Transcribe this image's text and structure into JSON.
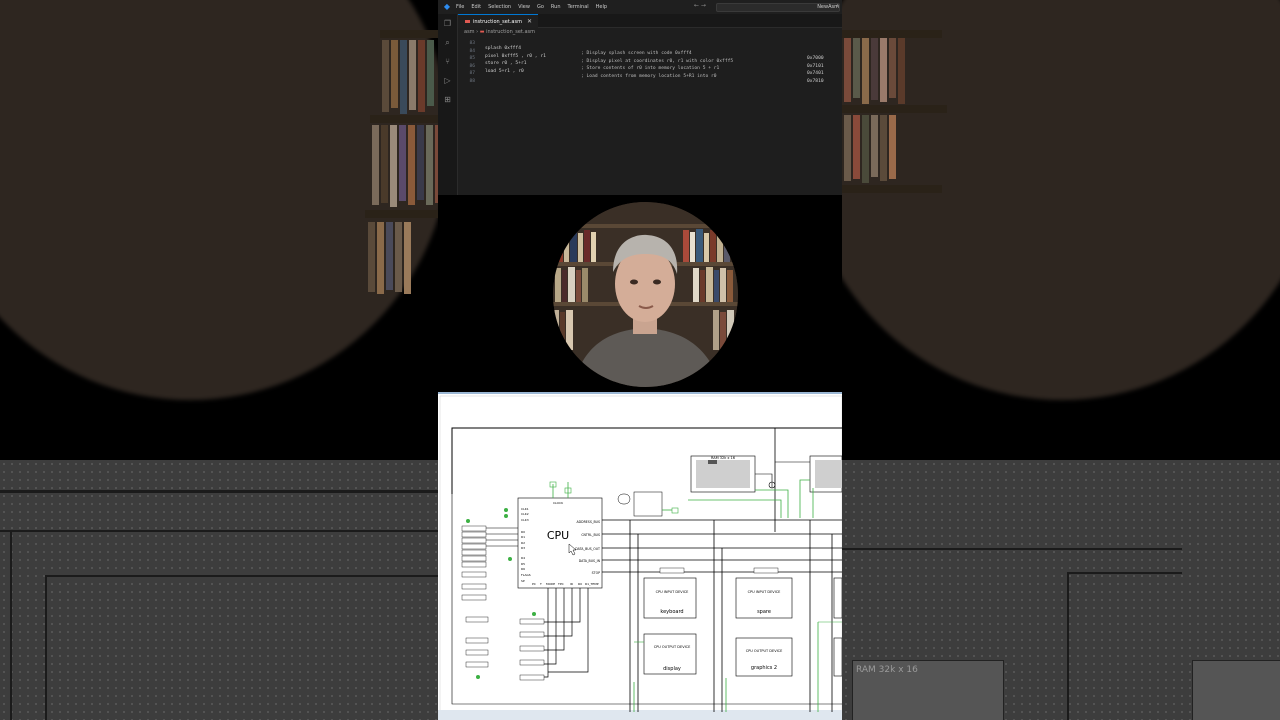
{
  "vscode": {
    "menu": [
      "File",
      "Edit",
      "Selection",
      "View",
      "Go",
      "Run",
      "Terminal",
      "Help"
    ],
    "command_center": "NewAsm",
    "tab": {
      "filename": "instruction_set.asm"
    },
    "breadcrumb": [
      "asm",
      "instruction_set.asm"
    ],
    "code_lines": [
      {
        "ln": "83",
        "instr": "splash 0xfff4",
        "comment": "; Display splash screen with code 0xfff4",
        "hex": "0x7000"
      },
      {
        "ln": "84",
        "instr": "pixel 0xfff5 , r0 , r1",
        "comment": "; Display pixel at coordinates r0, r1 with color 0xfff5",
        "hex": "0x7101"
      },
      {
        "ln": "85",
        "instr": "store r0 , 5+r1",
        "comment": "; Store contents of r0 into memory location 5 + r1",
        "hex": "0x7401"
      },
      {
        "ln": "86",
        "instr": "load 5+r1 , r0",
        "comment": "; Load contents from memory location 5+R1 into r0",
        "hex": "0x7810"
      },
      {
        "ln": "87",
        "instr": "",
        "comment": "",
        "hex": ""
      },
      {
        "ln": "88",
        "instr": "",
        "comment": "",
        "hex": ""
      }
    ],
    "colors": {
      "background": "#1e1e1e",
      "accent": "#0078d4",
      "asm_icon": "#e05a52"
    }
  },
  "circuit": {
    "cpu_label": "CPU",
    "cpu_pins_right": [
      "ADDRESS_BUS",
      "CNTRL_BUS",
      "DATA_BUS_OUT",
      "DATA_BUS_IN",
      "STOP"
    ],
    "cpu_pins_left": [
      "CLK1",
      "CLK2",
      "CLK3",
      "R0",
      "R1",
      "R2",
      "R3",
      "R4",
      "R5",
      "R6",
      "FLAGS",
      "SP"
    ],
    "cpu_pins_bottom": [
      "PC",
      "T",
      "MODE",
      "TPC",
      "IR",
      "R0",
      "R1_TEMP"
    ],
    "devices": [
      {
        "title": "CPU INPUT DEVICE",
        "name": "keyboard"
      },
      {
        "title": "CPU INPUT DEVICE",
        "name": "spare"
      },
      {
        "title": "CPU OUTPUT DEVICE",
        "name": "display"
      },
      {
        "title": "CPU OUTPUT DEVICE",
        "name": "graphics 2"
      }
    ],
    "ram_label": "RAM 32k x 16",
    "clock_label": "CLOCK",
    "colors": {
      "active_wire": "#3cb043",
      "wire": "#000000"
    }
  }
}
